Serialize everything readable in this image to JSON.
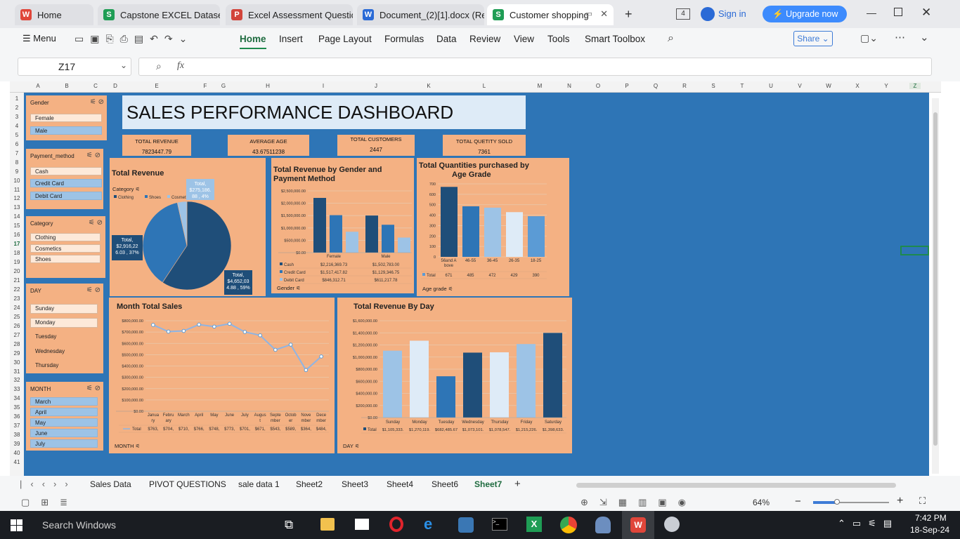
{
  "browser_tabs": [
    {
      "label": "Home",
      "icon": "W",
      "color": "#e0463a"
    },
    {
      "label": "Capstone EXCEL Dataset.xl",
      "icon": "S",
      "color": "#1f9d55"
    },
    {
      "label": "Excel Assessment Question",
      "icon": "P",
      "color": "#d2443a"
    },
    {
      "label": "Document_(2)[1].docx (Rea",
      "icon": "W",
      "color": "#2a6ad6"
    },
    {
      "label": "Customer shopping",
      "icon": "S",
      "color": "#1f9d55"
    }
  ],
  "header": {
    "tab_count": "4",
    "sign_in": "Sign in",
    "upgrade": "Upgrade now"
  },
  "toolbar": {
    "menu": "Menu",
    "items": [
      "Home",
      "Insert",
      "Page Layout",
      "Formulas",
      "Data",
      "Review",
      "View",
      "Tools",
      "Smart Toolbox"
    ],
    "share": "Share"
  },
  "formula": {
    "cell_ref": "Z17",
    "fx": "fx"
  },
  "columns": [
    "A",
    "B",
    "C",
    "D",
    "E",
    "F",
    "G",
    "H",
    "I",
    "J",
    "K",
    "L",
    "M",
    "N",
    "O",
    "P",
    "Q",
    "R",
    "S",
    "T",
    "U",
    "V",
    "W",
    "X",
    "Y",
    "Z"
  ],
  "dashboard": {
    "title": "SALES PERFORMANCE DASHBOARD",
    "kpis": [
      {
        "label": "TOTAL REVENUE",
        "value": "7823447.79"
      },
      {
        "label": "AVERAGE AGE",
        "value": "43.67511238"
      },
      {
        "label": "TOTAL CUSTOMERS",
        "value": "2447"
      },
      {
        "label": "TOTAL QUETITY SOLD",
        "value": "7361"
      }
    ],
    "slicers": {
      "gender": {
        "title": "Gender",
        "items": [
          "Female",
          "Male"
        ]
      },
      "payment": {
        "title": "Payment_method",
        "items": [
          "Cash",
          "Credit Card",
          "Debit Card"
        ]
      },
      "category": {
        "title": "Category",
        "items": [
          "Clothing",
          "Cosmetics",
          "Shoes"
        ]
      },
      "day": {
        "title": "DAY",
        "items": [
          "Sunday",
          "Monday",
          "Tuesday",
          "Wednesday",
          "Thursday"
        ]
      },
      "month": {
        "title": "MONTH",
        "items": [
          "March",
          "April",
          "May",
          "June",
          "July"
        ]
      }
    }
  },
  "chart_data": [
    {
      "type": "pie",
      "title": "Total Revenue",
      "filter": "Category",
      "legend": [
        "Clothing",
        "Shoes",
        "Cosmetics"
      ],
      "values": [
        4652034.88,
        2916226.03,
        275186.88
      ],
      "labels": [
        "Total, $4,652,034.88 , 59%",
        "Total, $2,916,226.03 , 37%",
        "Total, $275,186.88 , 4%"
      ],
      "colors": [
        "#1f4e79",
        "#2e75b6",
        "#9dc3e6"
      ]
    },
    {
      "type": "bar",
      "title": "Total Revenue by Gender and Payment Method",
      "filter": "Gender",
      "categories": [
        "Female",
        "Male"
      ],
      "series": [
        {
          "name": "Cash",
          "values": [
            2216369.73,
            1502783.0
          ],
          "display": [
            "$2,216,369.73",
            "$1,502,783.00"
          ],
          "color": "#1f4e79"
        },
        {
          "name": "Credit Card",
          "values": [
            1517417.82,
            1129346.75
          ],
          "display": [
            "$1,517,417.82",
            "$1,129,346.75"
          ],
          "color": "#2e75b6"
        },
        {
          "name": "Debit Card",
          "values": [
            846312.71,
            611217.78
          ],
          "display": [
            "$846,312.71",
            "$611,217.78"
          ],
          "color": "#9dc3e6"
        }
      ],
      "yticks": [
        "$0.00",
        "$500,000.00",
        "$1,000,000.00",
        "$1,500,000.00",
        "$2,000,000.00",
        "$2,500,000.00"
      ],
      "ylim": [
        0,
        2500000
      ]
    },
    {
      "type": "bar",
      "title": "Total Quantities purchased by Age Grade",
      "filter": "Age grade",
      "categories": [
        "56and Above",
        "46-55",
        "36-45",
        "26-35",
        "18-25"
      ],
      "category_display": [
        "56and A bove",
        "46-55",
        "36-45",
        "26-35",
        "18-25"
      ],
      "series": [
        {
          "name": "Total",
          "values": [
            671,
            485,
            472,
            429,
            390
          ]
        }
      ],
      "colors": [
        "#1f4e79",
        "#2e75b6",
        "#9dc3e6",
        "#deebf7",
        "#5b9bd5"
      ],
      "yticks": [
        "0",
        "100",
        "200",
        "300",
        "400",
        "500",
        "600",
        "700"
      ],
      "ylim": [
        0,
        700
      ]
    },
    {
      "type": "line",
      "title": "Month Total Sales",
      "filter": "MONTH",
      "categories": [
        "January",
        "February",
        "March",
        "April",
        "May",
        "June",
        "July",
        "August",
        "September",
        "October",
        "November",
        "December"
      ],
      "category_display": [
        "Janua ry",
        "Febru ary",
        "March",
        "April",
        "May",
        "June",
        "July",
        "Augus t",
        "Septe mber",
        "Octob er",
        "Nove mber",
        "Dece mber"
      ],
      "series": [
        {
          "name": "Total",
          "values": [
            763000,
            704000,
            710000,
            766000,
            748000,
            773000,
            701000,
            671000,
            543000,
            589000,
            364000,
            484000
          ],
          "display": [
            "$763,",
            "$704,",
            "$710,",
            "$766,",
            "$748,",
            "$773,",
            "$701,",
            "$671,",
            "$543,",
            "$589,",
            "$364,",
            "$484,"
          ]
        }
      ],
      "yticks": [
        "$0.00",
        "$100,000.00",
        "$200,000.00",
        "$300,000.00",
        "$400,000.00",
        "$500,000.00",
        "$600,000.00",
        "$700,000.00",
        "$800,000.00"
      ],
      "ylim": [
        0,
        800000
      ]
    },
    {
      "type": "bar",
      "title": "Total Revenue By Day",
      "filter": "DAY",
      "categories": [
        "Sunday",
        "Monday",
        "Tuesday",
        "Wednesday",
        "Thursday",
        "Friday",
        "Saturday"
      ],
      "series": [
        {
          "name": "Total",
          "values": [
            1105333,
            1270119,
            682485,
            1073101,
            1078547,
            1215226,
            1398633
          ],
          "display": [
            "$1,105,333.",
            "$1,270,119.",
            "$682,485.67",
            "$1,073,101.",
            "$1,078,547.",
            "$1,215,226.",
            "$1,398,633."
          ]
        }
      ],
      "colors": [
        "#9dc3e6",
        "#deebf7",
        "#2e75b6",
        "#1f4e79",
        "#deebf7",
        "#9dc3e6",
        "#1f4e79"
      ],
      "yticks": [
        "$0.00",
        "$200,000.00",
        "$400,000.00",
        "$600,000.00",
        "$800,000.00",
        "$1,000,000.00",
        "$1,200,000.00",
        "$1,400,000.00",
        "$1,600,000.00"
      ],
      "ylim": [
        0,
        1600000
      ]
    }
  ],
  "sheets": [
    "Sales Data",
    "PIVOT QUESTIONS",
    "sale data 1",
    "Sheet2",
    "Sheet3",
    "Sheet4",
    "Sheet6",
    "Sheet7"
  ],
  "status": {
    "zoom": "64%"
  },
  "taskbar": {
    "search": "Search Windows",
    "time": "7:42 PM",
    "date": "18-Sep-24"
  }
}
